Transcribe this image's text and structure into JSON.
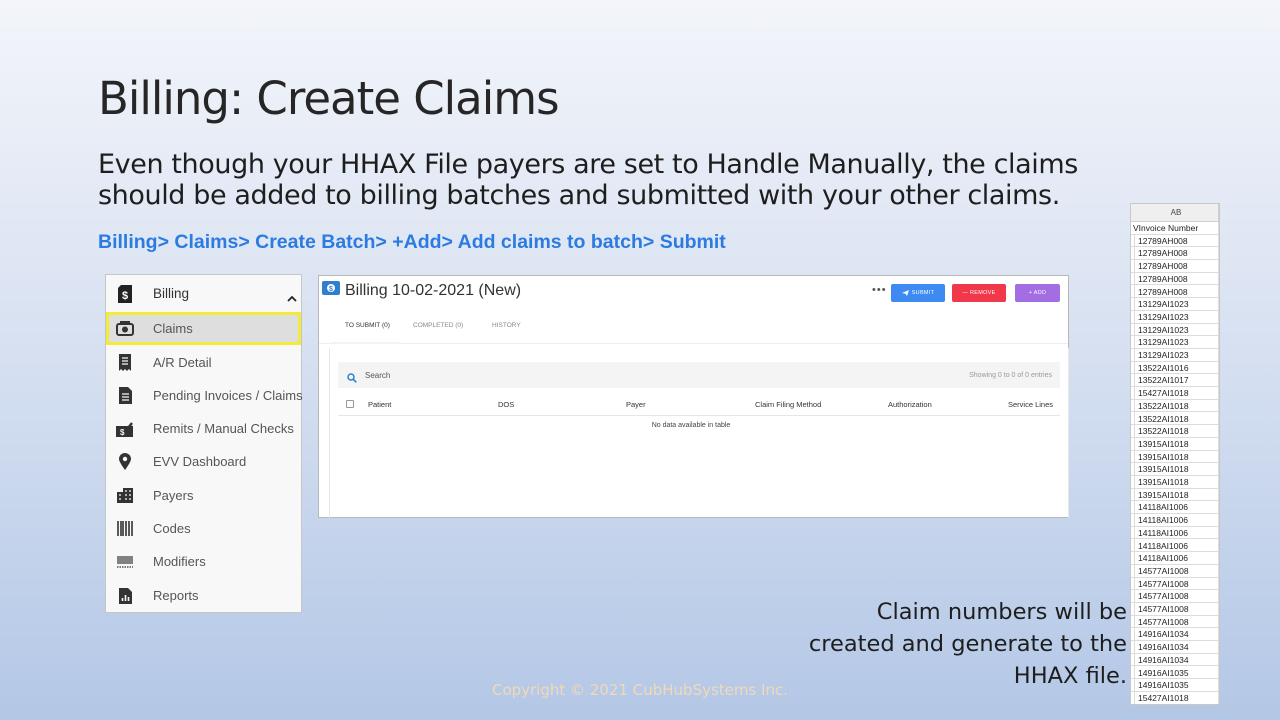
{
  "slide": {
    "title": "Billing: Create Claims",
    "subtitle": "Even though your HHAX File payers are set to Handle Manually, the claims should be added to billing batches and submitted with your other claims.",
    "path": "Billing> Claims> Create Batch> +Add> Add claims to batch> Submit",
    "claim_note": "Claim numbers will be created and generate to the HHAX file.",
    "copyright": "Copyright © 2021 CubHubSystems Inc."
  },
  "sidebar": {
    "header": "Billing",
    "items": [
      {
        "label": "Claims",
        "icon": "claims-icon",
        "selected": true
      },
      {
        "label": "A/R Detail",
        "icon": "receipt-icon"
      },
      {
        "label": "Pending Invoices / Claims",
        "icon": "document-icon"
      },
      {
        "label": "Remits / Manual Checks",
        "icon": "check-edit-icon"
      },
      {
        "label": "EVV Dashboard",
        "icon": "location-pin-icon"
      },
      {
        "label": "Payers",
        "icon": "building-icon"
      },
      {
        "label": "Codes",
        "icon": "barcode-icon"
      },
      {
        "label": "Modifiers",
        "icon": "barcode-small-icon"
      },
      {
        "label": "Reports",
        "icon": "report-icon"
      }
    ]
  },
  "batch": {
    "title": "Billing 10-02-2021 (New)",
    "more": "•••",
    "submit_label": "SUBMIT",
    "remove_label": "— REMOVE",
    "add_label": "+ ADD",
    "tabs": [
      "TO SUBMIT (0)",
      "COMPLETED (0)",
      "HISTORY"
    ],
    "search_placeholder": "Search",
    "showing": "Showing 0 to 0 of 0 entries",
    "columns": [
      "Patient",
      "DOS",
      "Payer",
      "Claim Filing Method",
      "Authorization",
      "Service Lines"
    ],
    "empty": "No data available in table",
    "accent_blue": "#3d8bf2",
    "accent_red": "#f0384a",
    "accent_purple": "#a36de3"
  },
  "excel": {
    "column_letter": "AB",
    "header": "Invoice Number",
    "left_edge": "V",
    "right_edge": "V",
    "rows": [
      "12789AH008",
      "12789AH008",
      "12789AH008",
      "12789AH008",
      "12789AH008",
      "13129AI1023",
      "13129AI1023",
      "13129AI1023",
      "13129AI1023",
      "13129AI1023",
      "13522AI1016",
      "13522AI1017",
      "15427AI1018",
      "13522AI1018",
      "13522AI1018",
      "13522AI1018",
      "13915AI1018",
      "13915AI1018",
      "13915AI1018",
      "13915AI1018",
      "13915AI1018",
      "14118AI1006",
      "14118AI1006",
      "14118AI1006",
      "14118AI1006",
      "14118AI1006",
      "14577AI1008",
      "14577AI1008",
      "14577AI1008",
      "14577AI1008",
      "14577AI1008",
      "14916AI1034",
      "14916AI1034",
      "14916AI1034",
      "14916AI1035",
      "14916AI1035",
      "15427AI1018"
    ]
  }
}
